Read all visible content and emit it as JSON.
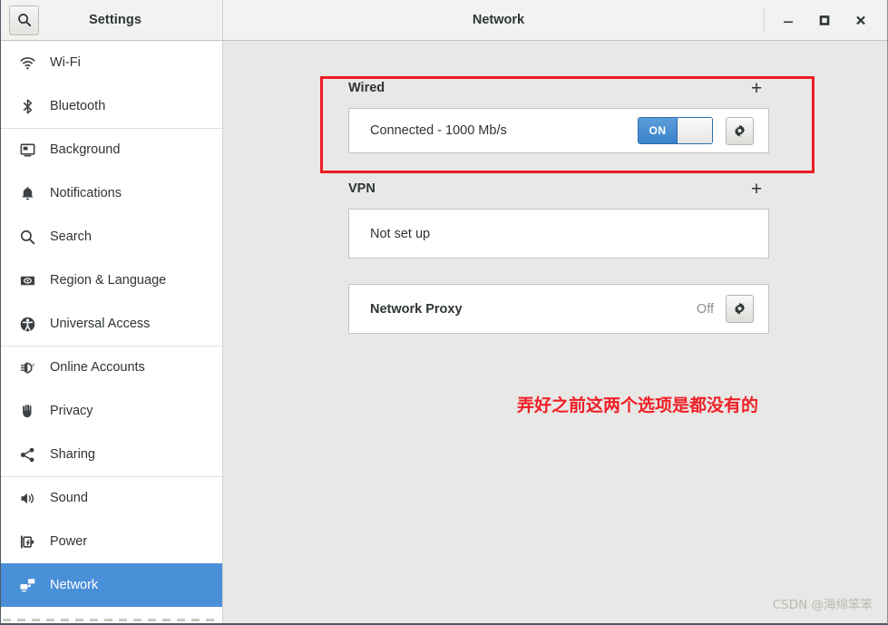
{
  "window": {
    "settings_title": "Settings",
    "page_title": "Network",
    "search_icon": "search-icon",
    "minimize_label": "Minimize",
    "maximize_label": "Maximize",
    "close_label": "Close"
  },
  "sidebar": {
    "items": [
      {
        "label": "Wi-Fi",
        "icon": "wifi-icon",
        "active": false,
        "separator_above": false
      },
      {
        "label": "Bluetooth",
        "icon": "bluetooth-icon",
        "active": false,
        "separator_above": false
      },
      {
        "label": "Background",
        "icon": "background-icon",
        "active": false,
        "separator_above": true
      },
      {
        "label": "Notifications",
        "icon": "bell-icon",
        "active": false,
        "separator_above": false
      },
      {
        "label": "Search",
        "icon": "search-icon",
        "active": false,
        "separator_above": false
      },
      {
        "label": "Region & Language",
        "icon": "region-language-icon",
        "active": false,
        "separator_above": false
      },
      {
        "label": "Universal Access",
        "icon": "accessibility-icon",
        "active": false,
        "separator_above": false
      },
      {
        "label": "Online Accounts",
        "icon": "online-accounts-icon",
        "active": false,
        "separator_above": true
      },
      {
        "label": "Privacy",
        "icon": "hand-icon",
        "active": false,
        "separator_above": false
      },
      {
        "label": "Sharing",
        "icon": "share-icon",
        "active": false,
        "separator_above": false
      },
      {
        "label": "Sound",
        "icon": "speaker-icon",
        "active": false,
        "separator_above": true
      },
      {
        "label": "Power",
        "icon": "power-battery-icon",
        "active": false,
        "separator_above": false
      },
      {
        "label": "Network",
        "icon": "network-icon",
        "active": true,
        "separator_above": false
      }
    ]
  },
  "main": {
    "wired": {
      "title": "Wired",
      "add_label": "+",
      "status": "Connected - 1000 Mb/s",
      "toggle_state": "ON",
      "settings_icon": "gear-icon"
    },
    "vpn": {
      "title": "VPN",
      "add_label": "+",
      "status": "Not set up"
    },
    "proxy": {
      "title": "Network Proxy",
      "state": "Off",
      "settings_icon": "gear-icon"
    },
    "annotation": "弄好之前这两个选项是都没有的"
  },
  "watermark": "CSDN @海绵笨笨",
  "colors": {
    "accent": "#4a90d9",
    "highlight": "#ed1c24",
    "annotation_text": "#ef2027",
    "window_bg": "#e8e8e6",
    "sidebar_bg": "#ffffff",
    "card_bg": "#ffffff"
  }
}
